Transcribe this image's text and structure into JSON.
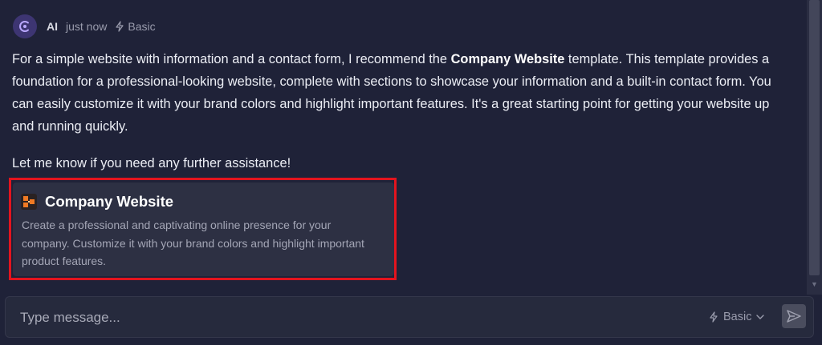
{
  "message": {
    "sender": "AI",
    "timestamp": "just now",
    "mode": "Basic",
    "paragraph1_before": "For a simple website with information and a contact form, I recommend the ",
    "paragraph1_bold": "Company Website",
    "paragraph1_after": " template. This template provides a foundation for a professional-looking website, complete with sections to showcase your information and a built-in contact form. You can easily customize it with your brand colors and highlight important features. It's a great starting point for getting your website up and running quickly.",
    "paragraph2": "Let me know if you need any further assistance!"
  },
  "template_card": {
    "title": "Company Website",
    "description": "Create a professional and captivating online presence for your company. Customize it with your brand colors and highlight important product features."
  },
  "composer": {
    "placeholder": "Type message...",
    "mode_label": "Basic"
  },
  "colors": {
    "background": "#1f2238",
    "card": "#2d3043",
    "highlight_border": "#e3141e",
    "accent": "#b9a8ff"
  },
  "icons": {
    "avatar": "ai-avatar-icon",
    "mode": "bolt-icon",
    "card_logo": "template-logo-icon",
    "dropdown": "chevron-down-icon",
    "send": "send-icon"
  }
}
